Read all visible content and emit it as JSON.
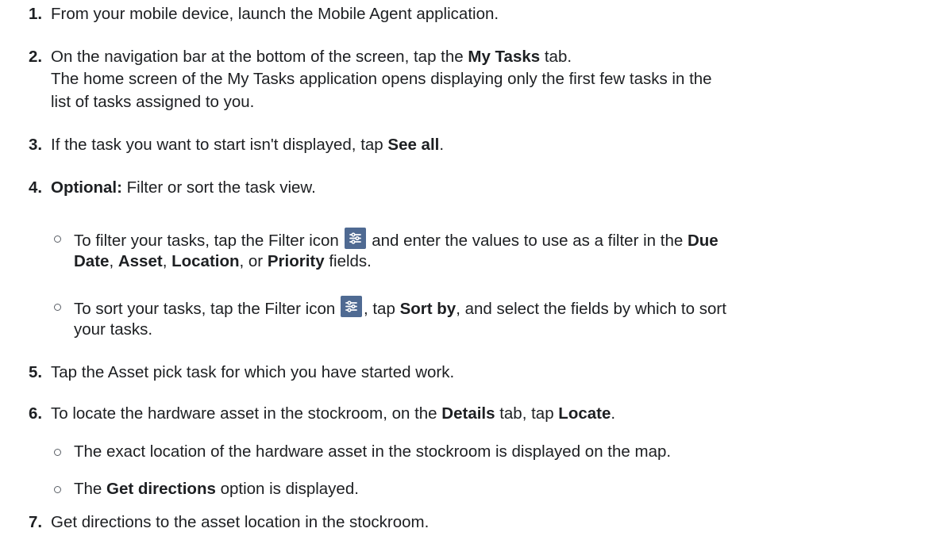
{
  "steps": {
    "s1": {
      "num": "1.",
      "text": "From your mobile device, launch the Mobile Agent application."
    },
    "s2": {
      "num": "2.",
      "a": "On the navigation bar at the bottom of the screen, tap the ",
      "b": "My Tasks",
      "c": " tab.",
      "line2": "The home screen of the My Tasks application opens displaying only the first few tasks in the",
      "line3": "list of tasks assigned to you."
    },
    "s3": {
      "num": "3.",
      "a": "If the task you want to start isn't displayed, tap ",
      "b": "See all",
      "c": "."
    },
    "s4": {
      "num": "4.",
      "b": "Optional:",
      "c": " Filter or sort the task view.",
      "bullet1": {
        "a": "To filter your tasks, tap the Filter icon ",
        "c": " and enter the values to use as a filter in the ",
        "d": "Due",
        "e": "Date",
        "f": ", ",
        "g": "Asset",
        "h": ", ",
        "i": "Location",
        "j": ", or ",
        "k": "Priority",
        "l": " fields."
      },
      "bullet2": {
        "a": "To sort your tasks, tap the Filter icon ",
        "c": ", tap ",
        "d": "Sort by",
        "e": ", and select the fields by which to sort",
        "f": "your tasks."
      }
    },
    "s5": {
      "num": "5.",
      "text": "Tap the Asset pick task for which you have started work."
    },
    "s6": {
      "num": "6.",
      "a": "To locate the hardware asset in the stockroom, on the ",
      "b": "Details",
      "c": " tab, tap ",
      "d": "Locate",
      "e": ".",
      "bullet1": "The exact location of the hardware asset in the stockroom is displayed on the map.",
      "bullet2": {
        "a": "The ",
        "b": "Get directions",
        "c": " option is displayed."
      }
    },
    "s7": {
      "num": "7.",
      "text": "Get directions to the asset location in the stockroom."
    }
  },
  "icons": {
    "filter": "filter-sliders-icon"
  },
  "colors": {
    "text": "#1d1f22",
    "icon_bg": "#4f6a92"
  }
}
